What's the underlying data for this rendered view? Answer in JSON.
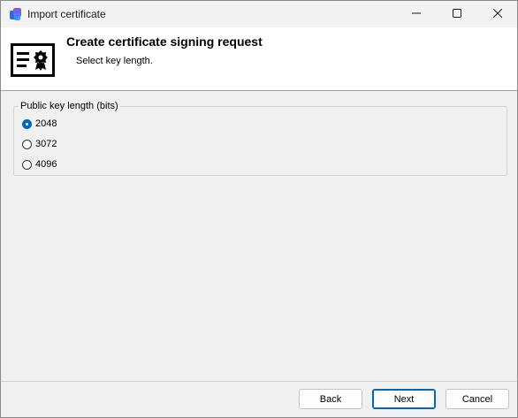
{
  "window": {
    "title": "Import certificate",
    "app_icon": "certificate-manager-icon",
    "controls": {
      "minimize": "minimize-icon",
      "maximize": "maximize-icon",
      "close": "close-icon"
    }
  },
  "header": {
    "title": "Create certificate signing request",
    "subtitle": "Select key length.",
    "icon": "certificate-icon"
  },
  "key_length": {
    "group_label": "Public key length (bits)",
    "options": [
      {
        "label": "2048",
        "selected": true
      },
      {
        "label": "3072",
        "selected": false
      },
      {
        "label": "4096",
        "selected": false
      }
    ]
  },
  "footer": {
    "back_label": "Back",
    "next_label": "Next",
    "cancel_label": "Cancel"
  },
  "colors": {
    "accent": "#0067c0",
    "header_bg": "#ffffff",
    "body_bg": "#f0f0f0"
  }
}
